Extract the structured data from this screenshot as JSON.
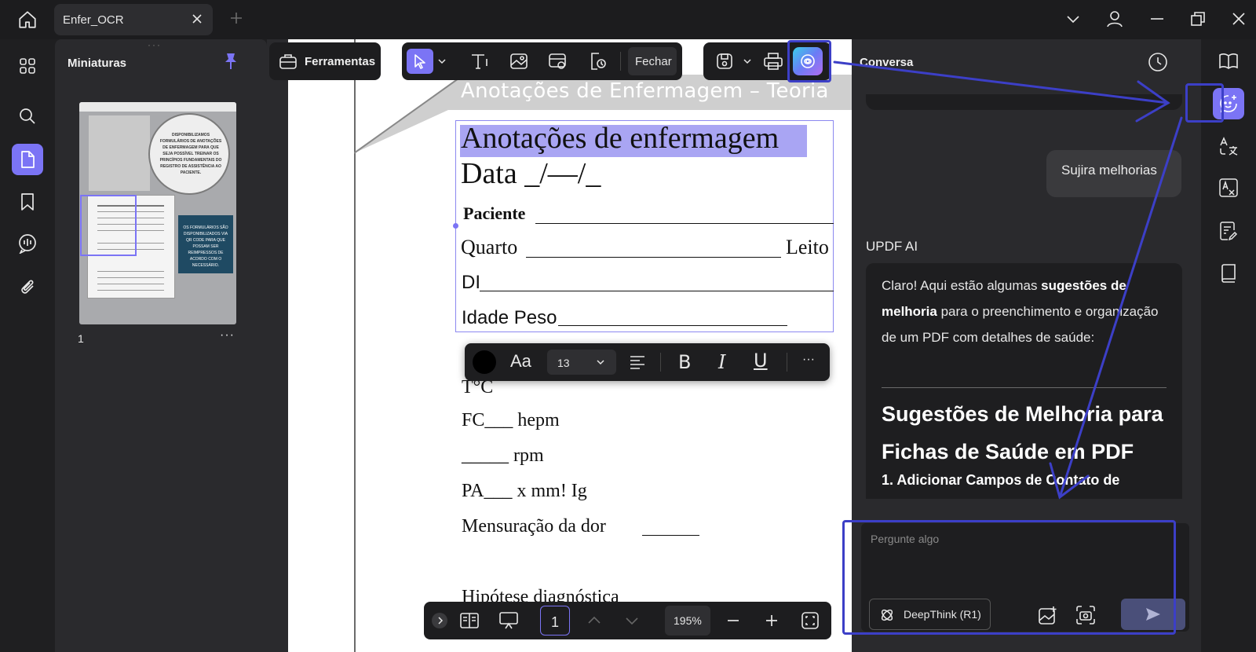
{
  "window": {
    "tab_title": "Enfer_OCR"
  },
  "sidebar": {
    "items": [
      {
        "icon": "grid-icon"
      },
      {
        "icon": "search-icon"
      },
      {
        "icon": "pages-icon",
        "active": true
      },
      {
        "icon": "bookmark-icon"
      },
      {
        "icon": "comment-icon"
      },
      {
        "icon": "attachment-icon"
      }
    ]
  },
  "thumbnails": {
    "title": "Miniaturas",
    "page_number": "1",
    "more": "···"
  },
  "thumb_text": {
    "circle": "DISPONIBILIZAMOS FORMULÁRIOS DE ANOTAÇÕES DE ENFERMAGEM PARA QUE SEJA POSSÍVEL TREINAR OS PRINCÍPIOS FUNDAMENTAIS DO REGISTRO DE ASSISTÊNCIA AO PACIENTE.",
    "box": "OS FORMULÁRIOS SÃO DISPONIBILIZADOS VIA QR CODE PARA QUE POSSAM SER REIMPRESSOS DE ACORDO COM O NECESSÁRIO."
  },
  "toolbar": {
    "tools_label": "Ferramentas",
    "close_label": "Fechar"
  },
  "document": {
    "banner": "Anotações de Enfermagem – Teoria",
    "heading": "Anotações de enfermagem",
    "date": "Data _/—/_",
    "patient": "Paciente",
    "room": "Quarto",
    "bed": "Leito",
    "di": "DI",
    "age_weight": "Idade Peso",
    "temp": "T°C",
    "fc": "FC___ hepm",
    "fr": "_____ rpm",
    "pa": "PA___ x mm! Ig",
    "pain": "Mensuração da dor",
    "hypothesis": "Hipótese diagnóstica"
  },
  "format_bar": {
    "font_label": "Aa",
    "size": "13",
    "more": "···"
  },
  "navbar": {
    "page": "1",
    "zoom": "195%"
  },
  "chat": {
    "title": "Conversa",
    "user_message": "Sujira melhorias",
    "ai_label": "UPDF AI",
    "ai_intro_1": "Claro! Aqui estão algumas ",
    "ai_intro_bold1": "sugestões de melhoria",
    "ai_intro_2": " para o preenchimento e organização de um PDF com detalhes de saúde:",
    "ai_heading": "Sugestões de Melhoria para Fichas de Saúde em PDF",
    "ai_sub": "1. Adicionar Campos de Contato de",
    "input_placeholder": "Pergunte algo",
    "deepthink_label": "DeepThink (R1)"
  },
  "colors": {
    "accent": "#7b74f5",
    "highlight_border": "#3c3fc7",
    "panel": "#2a2a2d",
    "background": "#1f1f21"
  }
}
